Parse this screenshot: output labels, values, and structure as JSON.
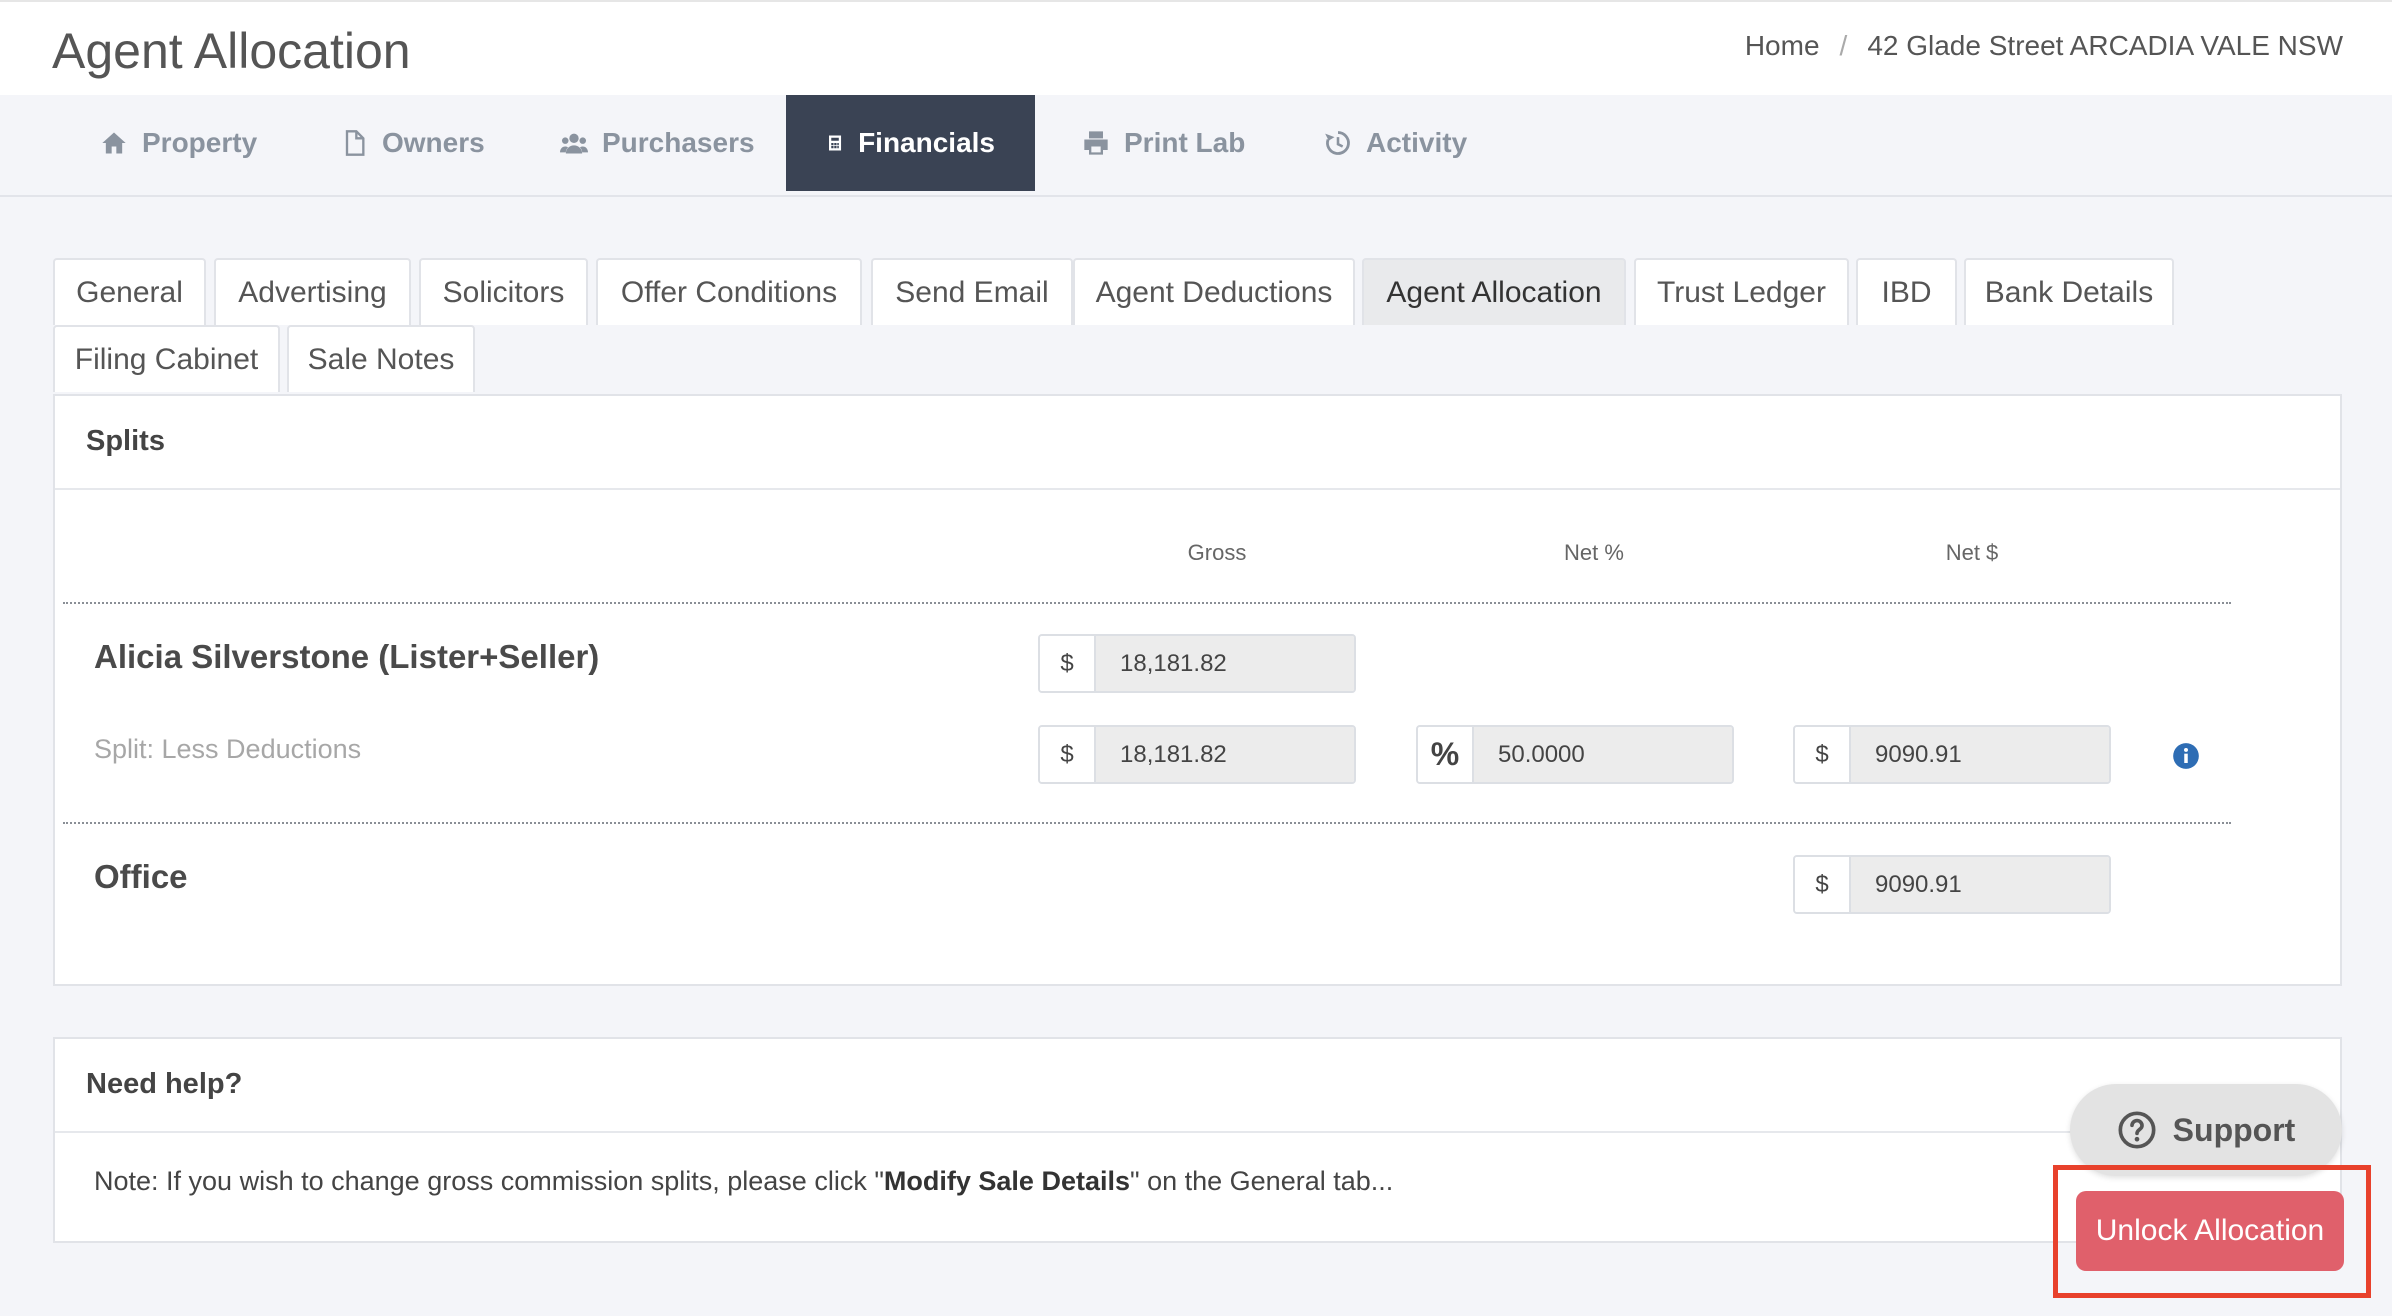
{
  "header": {
    "title": "Agent Allocation",
    "breadcrumb": {
      "home": "Home",
      "separator": "/",
      "current": "42 Glade Street ARCADIA VALE NSW"
    }
  },
  "nav": {
    "items": [
      {
        "label": "Property",
        "icon": "home-icon"
      },
      {
        "label": "Owners",
        "icon": "file-icon"
      },
      {
        "label": "Purchasers",
        "icon": "users-icon"
      },
      {
        "label": "Financials",
        "icon": "calculator-icon",
        "active": true
      },
      {
        "label": "Print Lab",
        "icon": "printer-icon"
      },
      {
        "label": "Activity",
        "icon": "history-icon"
      }
    ]
  },
  "subtabs": [
    "General",
    "Advertising",
    "Solicitors",
    "Offer Conditions",
    "Send Email",
    "Agent Deductions",
    "Agent Allocation",
    "Trust Ledger",
    "IBD",
    "Bank Details",
    "Filing Cabinet",
    "Sale Notes"
  ],
  "active_subtab": "Agent Allocation",
  "splits": {
    "title": "Splits",
    "columns": {
      "gross": "Gross",
      "net_pct": "Net %",
      "net_dollar": "Net $"
    },
    "agent": {
      "name": "Alicia Silverstone (Lister+Seller)",
      "gross_symbol": "$",
      "gross_value": "18,181.82",
      "split_label": "Split: Less Deductions",
      "split_gross_symbol": "$",
      "split_gross_value": "18,181.82",
      "pct_symbol": "%",
      "pct_value": "50.0000",
      "net_symbol": "$",
      "net_value": "9090.91"
    },
    "office": {
      "name": "Office",
      "net_symbol": "$",
      "net_value": "9090.91"
    }
  },
  "help": {
    "title": "Need help?",
    "note_prefix": "Note: If you wish to change gross commission splits, please click \"",
    "note_bold": "Modify Sale Details",
    "note_suffix": "\" on the General tab..."
  },
  "support_button": "Support",
  "unlock_button": "Unlock Allocation",
  "colors": {
    "nav_active": "#3a4354",
    "unlock_button": "#e0606b",
    "highlight_border": "#e8412c",
    "info_icon": "#2e6db4"
  }
}
